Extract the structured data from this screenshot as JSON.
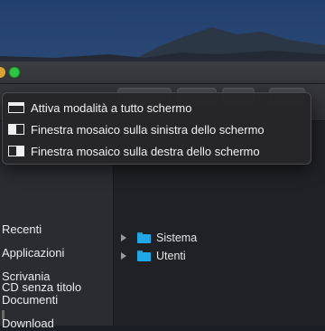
{
  "window": {
    "traffic_lights": [
      {
        "name": "minimize",
        "color": "#d9a431"
      },
      {
        "name": "fullscreen",
        "color": "#2ac840"
      }
    ]
  },
  "fullscreen_menu": {
    "items": [
      {
        "label": "Attiva modalità a tutto schermo",
        "icon": "fullscreen-icon"
      },
      {
        "label": "Finestra mosaico sulla sinistra dello schermo",
        "icon": "tile-left-icon"
      },
      {
        "label": "Finestra mosaico sulla destra dello schermo",
        "icon": "tile-right-icon"
      }
    ]
  },
  "sidebar": {
    "items": [
      {
        "label": "Recenti"
      },
      {
        "label": "Applicazioni"
      },
      {
        "label": "Scrivania"
      },
      {
        "label": "Documenti"
      },
      {
        "label": "Download"
      },
      {
        "label": "CD senza titolo"
      }
    ]
  },
  "content": {
    "rows": [
      {
        "label": "Sistema",
        "icon": "folder-icon"
      },
      {
        "label": "Utenti",
        "icon": "folder-icon"
      }
    ]
  },
  "colors": {
    "folder": "#1fa8e6",
    "menu_bg": "#262628",
    "accent_green": "#2ac840"
  }
}
